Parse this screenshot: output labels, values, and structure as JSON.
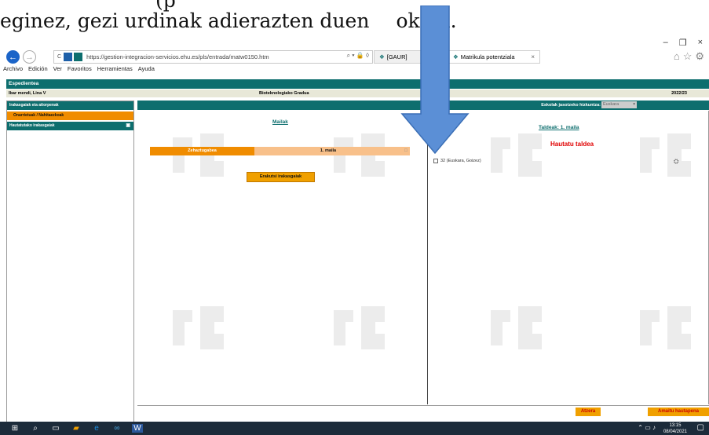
{
  "doc_text": {
    "line_top": "(p",
    "line_main_left": "eginez, gezi urdinak adierazten duen",
    "line_main_right": "okian."
  },
  "browser": {
    "url": "https://gestion-integracion-servicios.ehu.es/pls/entrada/matw0150.htm",
    "tabs": [
      {
        "label": "[GAUR]"
      },
      {
        "label": "Matrikula potentziala"
      }
    ],
    "menu": [
      "Archivo",
      "Edición",
      "Ver",
      "Favoritos",
      "Herramientas",
      "Ayuda"
    ]
  },
  "page": {
    "header_title": "Espedientea",
    "student_name": "Ibar mendi, Lina V",
    "degree": "Bioteknologiako Gradua",
    "academic_year": "2022/23"
  },
  "sidebar": {
    "items": [
      {
        "label": "Irakasgaiak eta aitorpenak"
      },
      {
        "label": "Onarrietuak / Nahitaezkoak"
      },
      {
        "label": "Hautatutako irakasgaiak"
      }
    ]
  },
  "main": {
    "lang_label": "Eskolak jasotzeko hizkuntza:",
    "lang_value": "Euskara",
    "mailak_link": "Mailak",
    "mailak_row": {
      "col1": "Zehaztugabea",
      "col2": "1. maila"
    },
    "show_teachers_button": "Erakutsi irakasgaiak",
    "taldeak_link": "Taldeak:   1. maila",
    "hautatu_title": "Hautatu taldea",
    "group_option": "32 (Euskara, Goizez)"
  },
  "footer": {
    "back_button": "Atzera",
    "finish_button": "Amaitu hautapena"
  },
  "taskbar": {
    "time": "13:15",
    "date": "08/04/2021"
  },
  "colors": {
    "teal": "#0d6e6e",
    "orange": "#f08c00",
    "arrow_blue": "#5b8fd6"
  }
}
